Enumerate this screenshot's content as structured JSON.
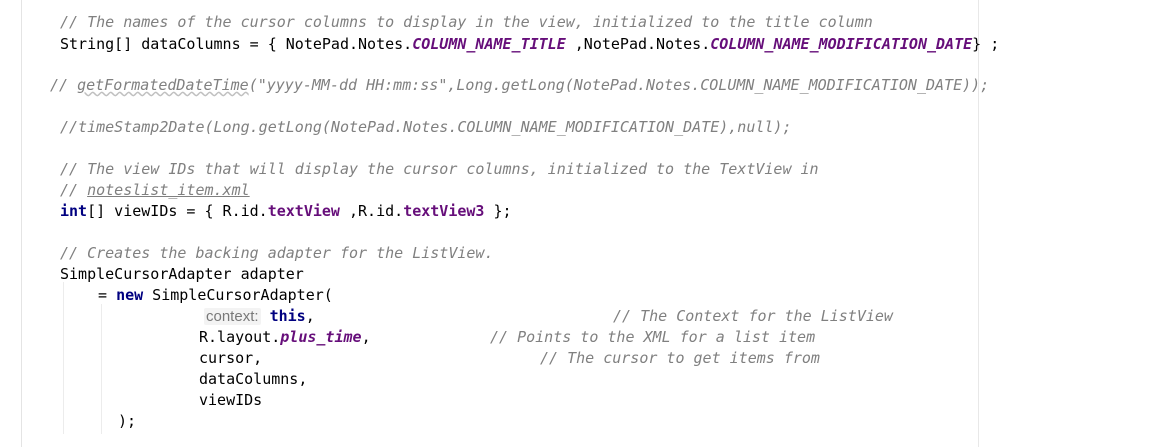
{
  "editor": {
    "lines": [
      {
        "tokens": [
          {
            "t": "cm",
            "v": "// The names of the cursor columns to display in the view, initialized to the title column"
          }
        ]
      },
      {
        "tokens": [
          {
            "t": "pl",
            "v": "String[] dataColumns = { NotePad.Notes."
          },
          {
            "t": "fld",
            "v": "COLUMN_NAME_TITLE"
          },
          {
            "t": "pl",
            "v": " ,NotePad.Notes."
          },
          {
            "t": "fld",
            "v": "COLUMN_NAME_MODIFICATION_DATE"
          },
          {
            "t": "pl",
            "v": "} ;"
          }
        ]
      },
      {
        "tokens": [
          {
            "t": "cm",
            "v": "// "
          },
          {
            "t": "cm squig",
            "v": "getFormatedDateTime"
          },
          {
            "t": "cm",
            "v": "(\"yyyy-MM-dd HH:mm:ss\",Long.getLong(NotePad.Notes.COLUMN_NAME_MODIFICATION_DATE));"
          }
        ]
      },
      {
        "tokens": [
          {
            "t": "cm",
            "v": "//timeStamp2Date(Long.getLong(NotePad.Notes.COLUMN_NAME_MODIFICATION_DATE),null);"
          }
        ]
      },
      {
        "tokens": [
          {
            "t": "cm",
            "v": "// The view IDs that will display the cursor columns, initialized to the TextView in"
          }
        ]
      },
      {
        "tokens": [
          {
            "t": "cm",
            "v": "// "
          },
          {
            "t": "cm ul",
            "v": "noteslist_item.xml"
          }
        ]
      },
      {
        "tokens": [
          {
            "t": "kw",
            "v": "int"
          },
          {
            "t": "pl",
            "v": "[] viewIDs = { R.id."
          },
          {
            "t": "idf",
            "v": "textView"
          },
          {
            "t": "pl",
            "v": " ,R.id."
          },
          {
            "t": "idf",
            "v": "textView3"
          },
          {
            "t": "pl",
            "v": " };"
          }
        ]
      },
      {
        "tokens": [
          {
            "t": "cm",
            "v": "// Creates the backing adapter for the ListView."
          }
        ]
      },
      {
        "tokens": [
          {
            "t": "pl",
            "v": "SimpleCursorAdapter adapter"
          }
        ]
      },
      {
        "tokens": [
          {
            "t": "pl",
            "v": "= "
          },
          {
            "t": "kw",
            "v": "new"
          },
          {
            "t": "pl",
            "v": " SimpleCursorAdapter("
          }
        ]
      },
      {
        "tokens": [
          {
            "t": "hint",
            "v": "context:"
          },
          {
            "t": "pl",
            "v": " "
          },
          {
            "t": "kw",
            "v": "this"
          },
          {
            "t": "pl",
            "v": ","
          }
        ]
      },
      {
        "tokens": [
          {
            "t": "cm",
            "v": "// The Context for the ListView"
          }
        ]
      },
      {
        "tokens": [
          {
            "t": "pl",
            "v": "R.layout."
          },
          {
            "t": "fld",
            "v": "plus_time"
          },
          {
            "t": "pl",
            "v": ","
          }
        ]
      },
      {
        "tokens": [
          {
            "t": "cm",
            "v": "// Points to the XML for a list item"
          }
        ]
      },
      {
        "tokens": [
          {
            "t": "pl",
            "v": "cursor,"
          }
        ]
      },
      {
        "tokens": [
          {
            "t": "cm",
            "v": "// The cursor to get items from"
          }
        ]
      },
      {
        "tokens": [
          {
            "t": "pl",
            "v": "dataColumns,"
          }
        ]
      },
      {
        "tokens": [
          {
            "t": "pl",
            "v": "viewIDs"
          }
        ]
      },
      {
        "tokens": [
          {
            "t": "pl",
            "v": ");"
          }
        ]
      }
    ]
  }
}
